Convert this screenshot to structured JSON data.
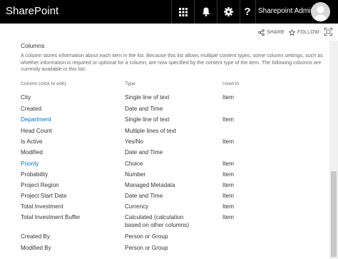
{
  "suitebar": {
    "brand": "SharePoint",
    "user_name": "Sharepoint Admini...",
    "icons": [
      "app-launcher-icon",
      "bell-icon",
      "gear-icon",
      "help-icon"
    ],
    "help_glyph": "?"
  },
  "actions": {
    "share_label": "SHARE",
    "follow_label": "FOLLOW"
  },
  "section": {
    "title": "Columns",
    "description": "A column stores information about each item in the list. Because this list allows multiple content types, some column settings, such as whether information is required or optional for a column, are now specified by the content type of the item. The following columns are currently available in this list:"
  },
  "table": {
    "headers": [
      "Column (click to edit)",
      "Type",
      "Used in"
    ],
    "rows": [
      {
        "name": "City",
        "type": "Single line of text",
        "used_in": "Item",
        "link": false
      },
      {
        "name": "Created",
        "type": "Date and Time",
        "used_in": "",
        "link": false
      },
      {
        "name": "Department",
        "type": "Single line of text",
        "used_in": "Item",
        "link": true
      },
      {
        "name": "Head Count",
        "type": "Multiple lines of text",
        "used_in": "",
        "link": false
      },
      {
        "name": "Is Active",
        "type": "Yes/No",
        "used_in": "Item",
        "link": false
      },
      {
        "name": "Modified",
        "type": "Date and Time",
        "used_in": "",
        "link": false
      },
      {
        "name": "Priority",
        "type": "Choice",
        "used_in": "Item",
        "link": true
      },
      {
        "name": "Probability",
        "type": "Number",
        "used_in": "Item",
        "link": false
      },
      {
        "name": "Project Region",
        "type": "Managed Metadata",
        "used_in": "Item",
        "link": false
      },
      {
        "name": "Project Start Date",
        "type": "Date and Time",
        "used_in": "Item",
        "link": false
      },
      {
        "name": "Total Investment",
        "type": "Currency",
        "used_in": "Item",
        "link": false
      },
      {
        "name": "Total Investment Buffer",
        "type_lines": [
          "Calculated (calculation",
          "based on other columns)"
        ],
        "used_in": "Item",
        "link": false
      },
      {
        "name": "Created By",
        "type": "Person or Group",
        "used_in": "",
        "link": false
      },
      {
        "name": "Modified By",
        "type": "Person or Group",
        "used_in": "",
        "link": false
      }
    ]
  },
  "colors": {
    "suitebar_bg": "#000000",
    "link": "#0072c6",
    "text": "#333333"
  }
}
